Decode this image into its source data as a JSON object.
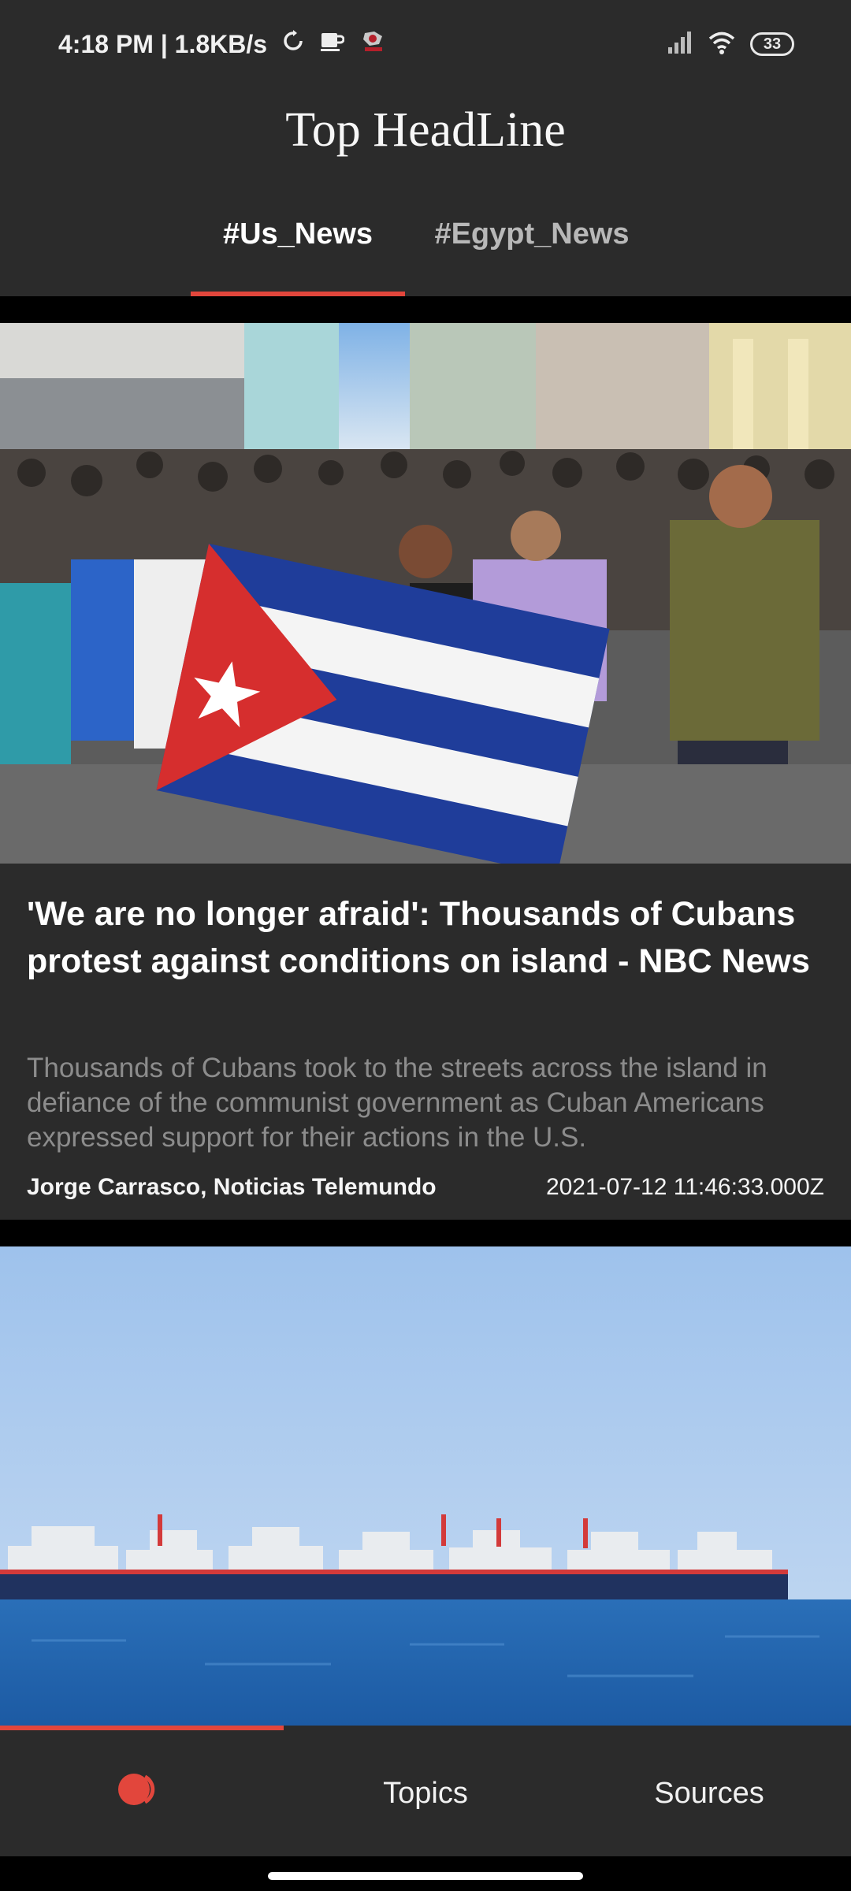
{
  "status_bar": {
    "time_and_speed": "4:18 PM | 1.8KB/s",
    "battery": "33"
  },
  "app": {
    "title": "Top HeadLine"
  },
  "tabs": [
    {
      "label": "#Us_News",
      "selected": true
    },
    {
      "label": "#Egypt_News",
      "selected": false
    }
  ],
  "articles": [
    {
      "title": "'We are no longer afraid': Thousands of Cubans protest against conditions on island - NBC News",
      "description": "Thousands of Cubans took to the streets across the island in defiance of the communist government as Cuban Americans expressed support for their actions in the U.S.",
      "author": "Jorge Carrasco, Noticias Telemundo",
      "published": "2021-07-12 11:46:33.000Z"
    }
  ],
  "bottom_nav": {
    "home_icon": "toggle-dot-icon",
    "topics_label": "Topics",
    "sources_label": "Sources",
    "active_index": 0
  },
  "colors": {
    "accent": "#e2463c",
    "surface": "#2b2b2b",
    "background": "#000000"
  }
}
